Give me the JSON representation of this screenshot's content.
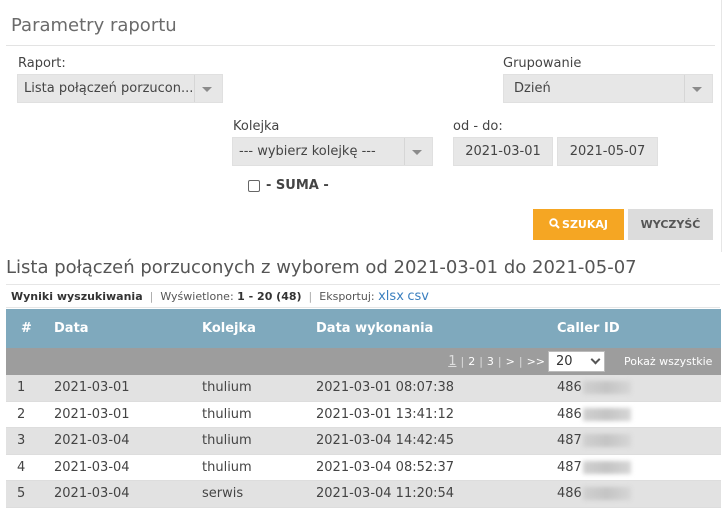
{
  "params": {
    "title": "Parametry raportu",
    "raport_label": "Raport:",
    "raport_value": "Lista połączeń porzucon...",
    "grupowanie_label": "Grupowanie",
    "grupowanie_value": "Dzień",
    "kolejka_label": "Kolejka",
    "kolejka_value": "--- wybierz kolejkę ---",
    "date_label": "od - do:",
    "date_from": "2021-03-01",
    "date_to": "2021-05-07",
    "suma_label": "- SUMA -",
    "search_button": "SZUKAJ",
    "clear_button": "WYCZYŚĆ"
  },
  "results": {
    "title": "Lista połączeń porzuconych z wyborem od 2021-03-01 do 2021-05-07",
    "info_label": "Wyniki wyszukiwania",
    "displayed_label": "Wyświetlone:",
    "displayed_value": "1 - 20 (48)",
    "export_label": "Eksportuj:",
    "export_xlsx": "xlsx",
    "export_csv": "csv"
  },
  "table": {
    "columns": [
      "#",
      "Data",
      "Kolejka",
      "Data wykonania",
      "Caller ID"
    ],
    "pager": {
      "pages": [
        "1",
        "2",
        "3",
        ">",
        ">>"
      ],
      "per_page": "20",
      "show_all": "Pokaż wszystkie"
    },
    "rows": [
      {
        "num": "1",
        "date": "2021-03-01",
        "queue": "thulium",
        "exec": "2021-03-01 08:07:38",
        "caller": "486"
      },
      {
        "num": "2",
        "date": "2021-03-01",
        "queue": "thulium",
        "exec": "2021-03-01 13:41:12",
        "caller": "486"
      },
      {
        "num": "3",
        "date": "2021-03-04",
        "queue": "thulium",
        "exec": "2021-03-04 14:42:45",
        "caller": "487"
      },
      {
        "num": "4",
        "date": "2021-03-04",
        "queue": "thulium",
        "exec": "2021-03-04 08:52:37",
        "caller": "487"
      },
      {
        "num": "5",
        "date": "2021-03-04",
        "queue": "serwis",
        "exec": "2021-03-04 11:20:54",
        "caller": "486"
      }
    ]
  },
  "colors": {
    "accent": "#f5a623",
    "table_header": "#7fa9bd",
    "pager_bg": "#9d9d9d",
    "link": "#3a7fbf"
  },
  "icons": {
    "search": "search-icon",
    "select_caret": "caret-down-icon"
  }
}
